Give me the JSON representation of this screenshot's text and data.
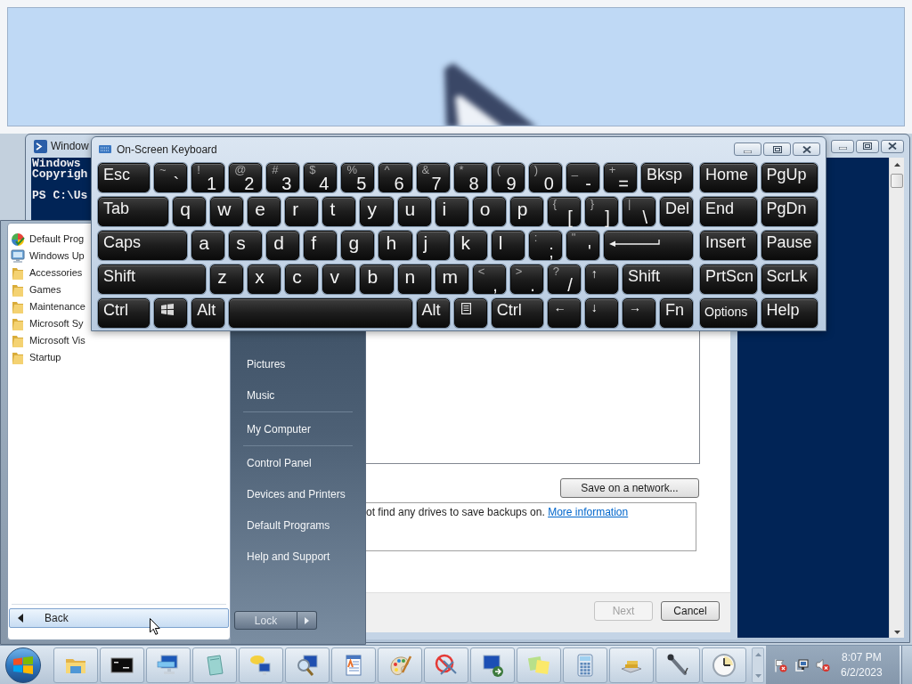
{
  "powershell": {
    "title": "Window",
    "banner": [
      "Windows",
      "Copyrigh"
    ],
    "prompt": "PS C:\\Us"
  },
  "keyboard": {
    "title": "On-Screen Keyboard",
    "main_rows": [
      [
        {
          "kind": "label",
          "label": "Esc"
        },
        {
          "kind": "dual",
          "shift": "~",
          "label": "`"
        },
        {
          "kind": "dual",
          "shift": "!",
          "label": "1"
        },
        {
          "kind": "dual",
          "shift": "@",
          "label": "2"
        },
        {
          "kind": "dual",
          "shift": "#",
          "label": "3"
        },
        {
          "kind": "dual",
          "shift": "$",
          "label": "4"
        },
        {
          "kind": "dual",
          "shift": "%",
          "label": "5"
        },
        {
          "kind": "dual",
          "shift": "^",
          "label": "6"
        },
        {
          "kind": "dual",
          "shift": "&",
          "label": "7"
        },
        {
          "kind": "dual",
          "shift": "*",
          "label": "8"
        },
        {
          "kind": "dual",
          "shift": "(",
          "label": "9"
        },
        {
          "kind": "dual",
          "shift": ")",
          "label": "0"
        },
        {
          "kind": "dual",
          "shift": "_",
          "label": "-"
        },
        {
          "kind": "dual",
          "shift": "+",
          "label": "="
        },
        {
          "kind": "label",
          "label": "Bksp"
        }
      ],
      [
        {
          "kind": "label",
          "label": "Tab"
        },
        {
          "kind": "letter",
          "label": "q"
        },
        {
          "kind": "letter",
          "label": "w"
        },
        {
          "kind": "letter",
          "label": "e"
        },
        {
          "kind": "letter",
          "label": "r"
        },
        {
          "kind": "letter",
          "label": "t"
        },
        {
          "kind": "letter",
          "label": "y"
        },
        {
          "kind": "letter",
          "label": "u"
        },
        {
          "kind": "letter",
          "label": "i"
        },
        {
          "kind": "letter",
          "label": "o"
        },
        {
          "kind": "letter",
          "label": "p"
        },
        {
          "kind": "dual",
          "shift": "{",
          "label": "["
        },
        {
          "kind": "dual",
          "shift": "}",
          "label": "]"
        },
        {
          "kind": "dual",
          "shift": "|",
          "label": "\\"
        },
        {
          "kind": "label",
          "label": "Del"
        }
      ],
      [
        {
          "kind": "label",
          "label": "Caps"
        },
        {
          "kind": "letter",
          "label": "a"
        },
        {
          "kind": "letter",
          "label": "s"
        },
        {
          "kind": "letter",
          "label": "d"
        },
        {
          "kind": "letter",
          "label": "f"
        },
        {
          "kind": "letter",
          "label": "g"
        },
        {
          "kind": "letter",
          "label": "h"
        },
        {
          "kind": "letter",
          "label": "j"
        },
        {
          "kind": "letter",
          "label": "k"
        },
        {
          "kind": "letter",
          "label": "l"
        },
        {
          "kind": "dual",
          "shift": ":",
          "label": ";"
        },
        {
          "kind": "dual",
          "shift": "\"",
          "label": "'"
        },
        {
          "kind": "enter"
        }
      ],
      [
        {
          "kind": "label",
          "label": "Shift"
        },
        {
          "kind": "letter",
          "label": "z"
        },
        {
          "kind": "letter",
          "label": "x"
        },
        {
          "kind": "letter",
          "label": "c"
        },
        {
          "kind": "letter",
          "label": "v"
        },
        {
          "kind": "letter",
          "label": "b"
        },
        {
          "kind": "letter",
          "label": "n"
        },
        {
          "kind": "letter",
          "label": "m"
        },
        {
          "kind": "dual",
          "shift": "<",
          "label": ","
        },
        {
          "kind": "dual",
          "shift": ">",
          "label": "."
        },
        {
          "kind": "dual",
          "shift": "?",
          "label": "/"
        },
        {
          "kind": "arrow",
          "label": "↑"
        },
        {
          "kind": "label",
          "label": "Shift"
        }
      ],
      [
        {
          "kind": "label",
          "label": "Ctrl"
        },
        {
          "kind": "windows"
        },
        {
          "kind": "label",
          "label": "Alt"
        },
        {
          "kind": "space"
        },
        {
          "kind": "label",
          "label": "Alt"
        },
        {
          "kind": "menu"
        },
        {
          "kind": "label",
          "label": "Ctrl"
        },
        {
          "kind": "arrow",
          "label": "←"
        },
        {
          "kind": "arrow",
          "label": "↓"
        },
        {
          "kind": "arrow",
          "label": "→"
        },
        {
          "kind": "label",
          "label": "Fn"
        }
      ]
    ],
    "nav_rows": [
      [
        {
          "kind": "label",
          "label": "Home"
        },
        {
          "kind": "label",
          "label": "PgUp"
        }
      ],
      [
        {
          "kind": "label",
          "label": "End"
        },
        {
          "kind": "label",
          "label": "PgDn"
        }
      ],
      [
        {
          "kind": "label",
          "label": "Insert"
        },
        {
          "kind": "label",
          "label": "Pause"
        }
      ],
      [
        {
          "kind": "label",
          "label": "PrtScn"
        },
        {
          "kind": "label",
          "label": "ScrLk"
        }
      ],
      [
        {
          "kind": "small",
          "label": "Options"
        },
        {
          "kind": "label",
          "label": "Help"
        }
      ]
    ]
  },
  "start_menu": {
    "programs": [
      {
        "kind": "programs",
        "label": "Default Prog"
      },
      {
        "kind": "update",
        "label": "Windows Up"
      },
      {
        "kind": "folder",
        "label": "Accessories"
      },
      {
        "kind": "folder",
        "label": "Games"
      },
      {
        "kind": "folder",
        "label": "Maintenance"
      },
      {
        "kind": "folder",
        "label": "Microsoft Sy"
      },
      {
        "kind": "folder",
        "label": "Microsoft Vis"
      },
      {
        "kind": "folder",
        "label": "Startup"
      }
    ],
    "back": "Back",
    "place_groups": [
      [
        "Pictures",
        "Music"
      ],
      [
        "My Computer"
      ],
      [
        "Control Panel",
        "Devices and Printers",
        "Default Programs",
        "Help and Support"
      ]
    ],
    "lock": "Lock"
  },
  "backup_dialog": {
    "network_button": "Save on a network...",
    "message": "ot find any drives to save backups on.",
    "link": "More information",
    "buttons": [
      {
        "label": "Next",
        "disabled": true
      },
      {
        "label": "Cancel",
        "disabled": false
      }
    ]
  },
  "taskbar": {
    "time": "8:07 PM",
    "date": "6/2/2023"
  }
}
